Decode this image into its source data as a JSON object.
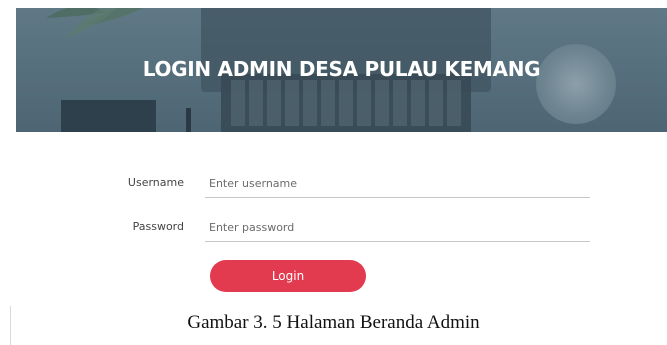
{
  "header": {
    "title": "LOGIN ADMIN DESA PULAU KEMANG"
  },
  "form": {
    "username": {
      "label": "Username",
      "placeholder": "Enter username",
      "value": ""
    },
    "password": {
      "label": "Password",
      "placeholder": "Enter password",
      "value": ""
    },
    "login_label": "Login"
  },
  "caption": "Gambar 3. 5 Halaman Beranda Admin",
  "colors": {
    "accent": "#e23a4e",
    "banner": "#5f7785"
  }
}
